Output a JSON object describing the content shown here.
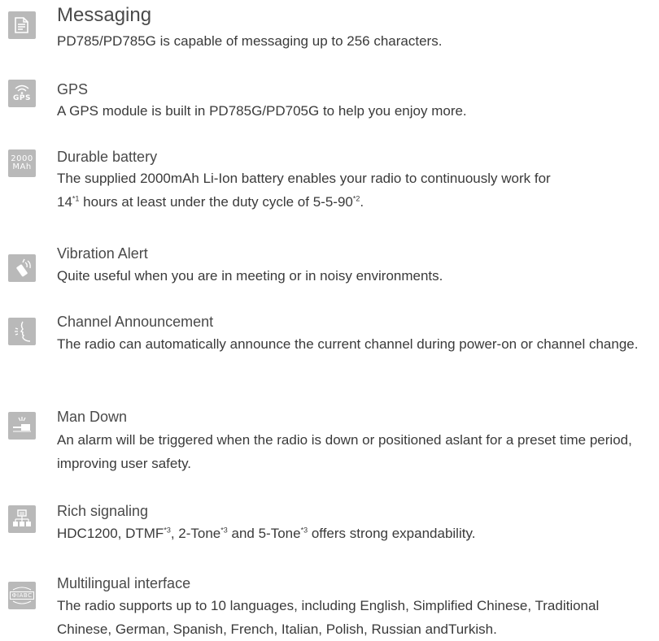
{
  "features": [
    {
      "icon": "messaging-icon",
      "title": "Messaging",
      "desc": "PD785/PD785G is capable of messaging up to 256 characters."
    },
    {
      "icon": "gps-icon",
      "icon_text": "GPS",
      "title": "GPS",
      "desc": "A GPS module is built in PD785G/PD705G to help you enjoy more."
    },
    {
      "icon": "battery-icon",
      "icon_text_top": "2000",
      "icon_text_bottom": "MAh",
      "title": "Durable battery",
      "desc_line1": "The supplied 2000mAh Li-Ion battery enables your radio to continuously work for",
      "desc_part_a": "14",
      "desc_sup_1": "*1",
      "desc_part_b": " hours at least under the duty cycle of 5-5-90",
      "desc_sup_2": "*2",
      "desc_part_c": "."
    },
    {
      "icon": "vibration-icon",
      "title": "Vibration Alert",
      "desc": "Quite useful when you are in meeting or in noisy environments."
    },
    {
      "icon": "voice-announcement-icon",
      "title": "Channel Announcement",
      "desc": "The radio can automatically announce the current channel during power-on or channel change."
    },
    {
      "icon": "man-down-icon",
      "title": "Man Down",
      "desc": "An alarm will be triggered when the radio is down or positioned aslant for a preset time period, improving user safety."
    },
    {
      "icon": "signaling-icon",
      "title": "Rich signaling",
      "desc_part_a": "HDC1200, DTMF",
      "desc_sup_1": "*3",
      "desc_part_b": ", 2-Tone",
      "desc_sup_2": "*3",
      "desc_part_c": " and 5-Tone",
      "desc_sup_3": "*3",
      "desc_part_d": " offers strong expandability."
    },
    {
      "icon": "language-icon",
      "icon_text": "ФIABC",
      "title": "Multilingual interface",
      "desc": "The radio supports up to 10 languages, including English, Simplified Chinese, Traditional Chinese, German, Spanish, French, Italian, Polish, Russian andTurkish."
    }
  ],
  "colors": {
    "icon_bg": "#b9b9b9",
    "text": "#3a3a3a"
  }
}
